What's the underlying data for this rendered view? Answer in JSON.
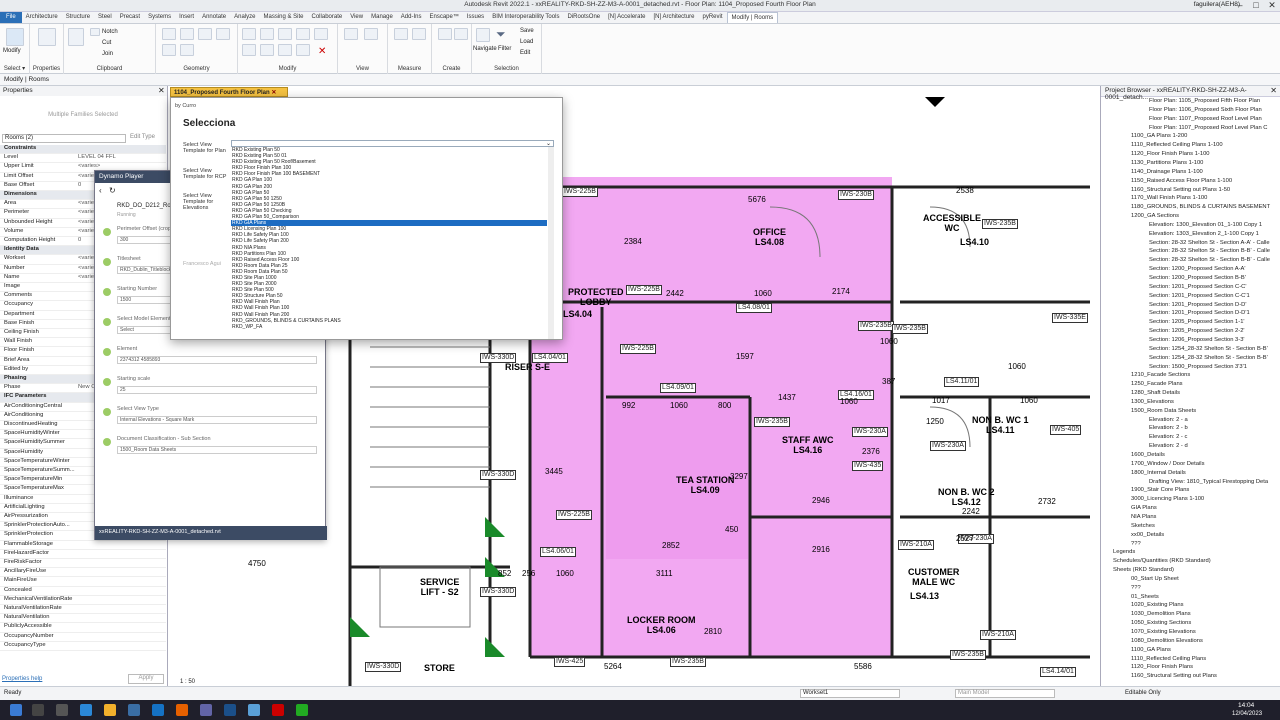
{
  "window": {
    "title": "Autodesk Revit 2022.1 - xxREALITY-RKD-SH-ZZ-M3-A-0001_detached.rvt - Floor Plan: 1104_Proposed Fourth Floor Plan",
    "user": "faguilera(AEH8)"
  },
  "tabs": [
    "File",
    "Architecture",
    "Structure",
    "Steel",
    "Precast",
    "Systems",
    "Insert",
    "Annotate",
    "Analyze",
    "Massing & Site",
    "Collaborate",
    "View",
    "Manage",
    "Add-Ins",
    "Enscape™",
    "Issues",
    "BIM Interoperability Tools",
    "DiRootsOne",
    "[N] Accelerate",
    "[N] Architecture",
    "pyRevit",
    "Modify | Rooms"
  ],
  "ribbon": {
    "groups": [
      "Select",
      "Properties",
      "Clipboard",
      "Geometry",
      "Modify",
      "View",
      "Measure",
      "Create",
      "Selection"
    ],
    "modify": "Modify",
    "properties": "Properties",
    "select": "Select ▾",
    "navigate": "Navigate",
    "filter": "Filter",
    "notch": "Notch",
    "cut": "Cut",
    "join": "Join",
    "paste": "Paste",
    "save": "Save",
    "load": "Load",
    "edit": "Edit"
  },
  "modbar": "Modify | Rooms",
  "properties": {
    "title": "Properties",
    "type_label": "Multiple Families Selected",
    "filter": "Rooms (2)",
    "edit_type": "Edit Type",
    "help": "Properties help",
    "apply": "Apply",
    "rows": [
      [
        "Constraints",
        ""
      ],
      [
        "Level",
        "LEVEL 04 FFL"
      ],
      [
        "Upper Limit",
        "<varies>"
      ],
      [
        "Limit Offset",
        "<varies>"
      ],
      [
        "Base Offset",
        "0"
      ],
      [
        "Dimensions",
        ""
      ],
      [
        "Area",
        "<varies>"
      ],
      [
        "Perimeter",
        "<varies>"
      ],
      [
        "Unbounded Height",
        "<varies>"
      ],
      [
        "Volume",
        "<varies>"
      ],
      [
        "Computation Height",
        "0"
      ],
      [
        "Identity Data",
        ""
      ],
      [
        "Workset",
        "<varies>"
      ],
      [
        "Number",
        "<varies>"
      ],
      [
        "Name",
        "<varies>"
      ],
      [
        "Image",
        ""
      ],
      [
        "Comments",
        ""
      ],
      [
        "Occupancy",
        ""
      ],
      [
        "Department",
        ""
      ],
      [
        "Base Finish",
        ""
      ],
      [
        "Ceiling Finish",
        ""
      ],
      [
        "Wall Finish",
        ""
      ],
      [
        "Floor Finish",
        ""
      ],
      [
        "Brief Area",
        ""
      ],
      [
        "Edited by",
        ""
      ],
      [
        "Phasing",
        ""
      ],
      [
        "Phase",
        "New C"
      ],
      [
        "IFC Parameters",
        ""
      ],
      [
        "AirConditioningCentral",
        ""
      ],
      [
        "AirConditioning",
        ""
      ],
      [
        "DiscontinuedHeating",
        ""
      ],
      [
        "SpaceHumidityWinter",
        ""
      ],
      [
        "SpaceHumiditySummer",
        ""
      ],
      [
        "SpaceHumidity",
        ""
      ],
      [
        "SpaceTemperatureWinter",
        ""
      ],
      [
        "SpaceTemperatureSumm...",
        ""
      ],
      [
        "SpaceTemperatureMin",
        ""
      ],
      [
        "SpaceTemperatureMax",
        ""
      ],
      [
        "Illuminance",
        ""
      ],
      [
        "ArtificialLighting",
        ""
      ],
      [
        "AirPressurization",
        ""
      ],
      [
        "SprinklerProtectionAuto...",
        ""
      ],
      [
        "SprinklerProtection",
        ""
      ],
      [
        "FlammableStorage",
        ""
      ],
      [
        "FireHazardFactor",
        ""
      ],
      [
        "FireRiskFactor",
        ""
      ],
      [
        "AncillaryFireUse",
        ""
      ],
      [
        "MainFireUse",
        ""
      ],
      [
        "Concealed",
        ""
      ],
      [
        "MechanicalVentilationRate",
        ""
      ],
      [
        "NaturalVentilationRate",
        ""
      ],
      [
        "NaturalVentilation",
        ""
      ],
      [
        "PubliclyAccessible",
        ""
      ],
      [
        "OccupancyNumber",
        ""
      ],
      [
        "OccupancyType",
        ""
      ]
    ]
  },
  "viewtab": "1104_Proposed Fourth Floor Plan",
  "dynamo": {
    "title": "Dynamo Player",
    "script": "RKD_DO_D212_Ro",
    "running": "Running",
    "file": "xxREALITY-RKD-SH-ZZ-M3-A-0001_detached.rvt",
    "fields": [
      [
        "Perimeter Offset (crop view)",
        "300"
      ],
      [
        "Titlesheet",
        "RKD_Dublin_Titleblock"
      ],
      [
        "Starting Number",
        "1500"
      ],
      [
        "Select Model Elements By Category",
        "Select"
      ],
      [
        "Element",
        "2374312 4585893"
      ],
      [
        "Starting scale",
        "25"
      ],
      [
        "Select View Type",
        "Internal Elevations - Square Mark"
      ],
      [
        "Document Classification - Sub Section",
        "1500_Room Data Sheets"
      ]
    ],
    "author": "Francesco Agui"
  },
  "selecciona": {
    "by": "by Curro",
    "heading": "Selecciona",
    "label_plan": "Select View Template for Plan",
    "label_rcp": "Select View Template for RCP",
    "label_elev": "Select View Template for Elevations",
    "items": [
      "RKD Existing Plan 50",
      "RKD Existing Plan 50 01",
      "RKD Existing Plan 50 Roof/Basement",
      "RKD Floor Finish Plan 100",
      "RKD Floor Finish Plan 100 BASEMENT",
      "RKD GA Plan 100",
      "RKD GA Plan 200",
      "RKD GA Plan 50",
      "RKD GA Plan 50 1250",
      "RKD GA Plan 50 1250B",
      "RKD GA Plan 50 Checking",
      "RKD GA Plan 50_Comparison",
      "RKD GIA Plans",
      "RKD Licensing Plan 100",
      "RKD Life Safety Plan 100",
      "RKD Life Safety Plan 200",
      "RKD NIA Plans",
      "RKD Partitions Plan 100",
      "RKD Raised Access Floor 100",
      "RKD Room Data Plan 25",
      "RKD Room Data Plan 50",
      "RKD Site Plan 1000",
      "RKD Site Plan 2000",
      "RKD Site Plan 500",
      "RKD Structure Plan 50",
      "RKD Wall Finish Plan",
      "RKD Wall Finish Plan 100",
      "RKD Wall Finish Plan 200",
      "RKD_GROUNDS, BLINDS & CURTAINS PLANS",
      "RKD_WP_FA"
    ],
    "highlight": 12
  },
  "plan": {
    "rooms": [
      [
        "OFFICE",
        "LS4.08"
      ],
      [
        "ACCESSIBLE",
        "WC"
      ],
      [
        "LS4.10",
        ""
      ],
      [
        "PROTECTED",
        "LOBBY"
      ],
      [
        "LS4.04",
        ""
      ],
      [
        "TEA STATION",
        "LS4.09"
      ],
      [
        "STAFF AWC",
        "LS4.16"
      ],
      [
        "NON B. WC 1",
        "LS4.11"
      ],
      [
        "NON B. WC 2",
        "LS4.12"
      ],
      [
        "CUSTOMER",
        "MALE WC"
      ],
      [
        "LS4.13",
        ""
      ],
      [
        "SERVICE",
        "LIFT - S2"
      ],
      [
        "LOCKER ROOM",
        "LS4.06"
      ],
      [
        "STORE",
        ""
      ],
      [
        "RISER S-E",
        ""
      ]
    ],
    "tags": [
      "IWS-225B",
      "IWS-230B",
      "IWS-235B",
      "IWS-225B",
      "IWS-235B",
      "IWS-335E",
      "IWS-225B",
      "IWS-330D",
      "IWS-235B",
      "IWS-230A",
      "IWS-405",
      "IWS-435",
      "IWS-230A",
      "IWS-210A",
      "IWS-230A",
      "IWS-330D",
      "IWS-225B",
      "IWS-330D",
      "IWS-425",
      "IWS-235B",
      "IWS-235B",
      "IWS-210A",
      "IWS-330D",
      "IWS-235B",
      "LS4.08/01",
      "LS4.09/01",
      "LS4.16/01",
      "LS4.11/01",
      "LS4.06/01",
      "LS4.14/01",
      "LS4.04/01"
    ],
    "dims": [
      "5676",
      "2538",
      "2442",
      "1060",
      "2174",
      "1597",
      "1060",
      "387",
      "992",
      "1060",
      "800",
      "1437",
      "1060",
      "1017",
      "1060",
      "3445",
      "3297",
      "2852",
      "450",
      "2242",
      "2946",
      "2916",
      "2527",
      "852",
      "256",
      "1060",
      "3111",
      "4750",
      "2810",
      "5264",
      "5586",
      "1060",
      "2384",
      "2376",
      "2732",
      "1250"
    ]
  },
  "browser": {
    "title": "Project Browser - xxREALITY-RKD-SH-ZZ-M3-A-0001_detach...",
    "items": [
      "Floor Plan: 1105_Proposed Fifth Floor Plan",
      "Floor Plan: 1106_Proposed Sixth Floor Plan",
      "Floor Plan: 1107_Proposed Roof Level Plan",
      "Floor Plan: 1107_Proposed Roof Level Plan C",
      "1100_GA Plans 1-200",
      "1110_Reflected Ceiling Plans 1-100",
      "1120_Floor Finish Plans 1-100",
      "1130_Partitions Plans 1-100",
      "1140_Drainage Plans 1-100",
      "1150_Raised Access Floor Plans 1-100",
      "1160_Structural Setting out Plans 1-50",
      "1170_Wall Finish Plans 1-100",
      "1180_GROUNDS, BLINDS & CURTAINS BASEMENT",
      "1200_GA Sections",
      "Elevation: 1300_Elevation 01_1-100 Copy 1",
      "Elevation: 1303_Elevation 2_1-100 Copy 1",
      "Section: 28-32 Shelton St - Section A-A' - Calle",
      "Section: 28-32 Shelton St - Section B-B' - Calle",
      "Section: 28-32 Shelton St - Section B-B' - Calle",
      "Section: 1200_Proposed Section A-A'",
      "Section: 1200_Proposed Section B-B'",
      "Section: 1201_Proposed Section C-C'",
      "Section: 1201_Proposed Section C-C'1",
      "Section: 1201_Proposed Section D-D'",
      "Section: 1201_Proposed Section D-D'1",
      "Section: 1205_Proposed Section 1-1'",
      "Section: 1205_Proposed Section 2-2'",
      "Section: 1206_Proposed Section 3-3'",
      "Section: 1254_28-32 Shelton St - Section B-B'",
      "Section: 1254_28-32 Shelton St - Section B-B'",
      "Section: 1500_Proposed Section 3'3'1",
      "1210_Facade Sections",
      "1250_Facade Plans",
      "1280_Shaft Details",
      "1300_Elevations",
      "1500_Room Data Sheets",
      "Elevation: 2 - a",
      "Elevation: 2 - b",
      "Elevation: 2 - c",
      "Elevation: 2 - d",
      "1600_Details",
      "1700_Window / Door Details",
      "1800_Internal Details",
      "Drafting View: 1810_Typical Firestopping Deta",
      "1900_Stair Core Plans",
      "3000_Licencing Plans 1-100",
      "GIA Plans",
      "NIA Plans",
      "Sketches",
      "xx00_Details",
      "???",
      "Legends",
      "Schedules/Quantities (RKD Standard)",
      "Sheets (RKD Standard)",
      "00_Start Up Sheet",
      "???",
      "01_Sheets",
      "1020_Existing Plans",
      "1030_Demolition Plans",
      "1050_Existing Sections",
      "1070_Existing Elevations",
      "1080_Demolition Elevations",
      "1100_GA Plans",
      "1110_Reflected Ceiling Plans",
      "1120_Floor Finish Plans",
      "1160_Structural Setting out Plans"
    ]
  },
  "status": {
    "left": "Ready",
    "scale": "1 : 50",
    "workset": "Workset1",
    "model": "Main Model",
    "editable": "Editable Only"
  },
  "clock": {
    "time": "14:04",
    "date": "12/04/2023"
  }
}
